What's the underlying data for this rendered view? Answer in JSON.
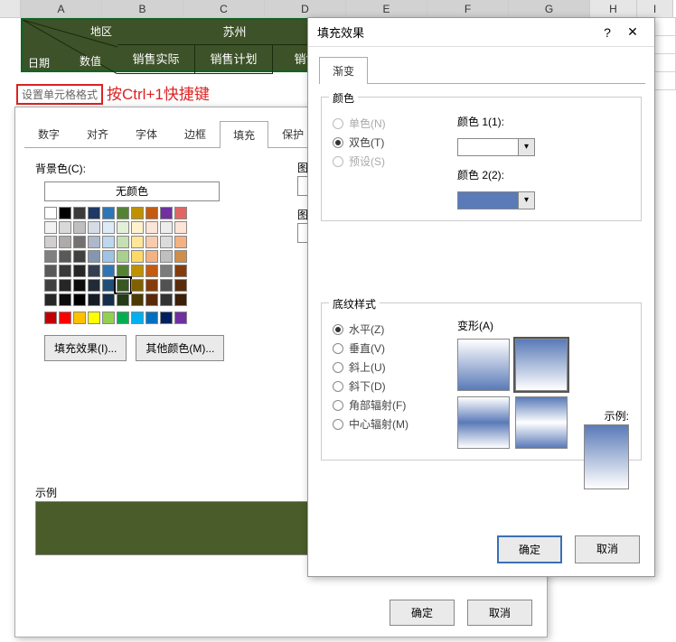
{
  "columns": [
    "A",
    "B",
    "C",
    "D",
    "E",
    "F",
    "G",
    "H",
    "I"
  ],
  "header": {
    "region_label": "地区",
    "date_label": "日期",
    "value_label": "数值",
    "city": "苏州",
    "cols": [
      "销售实际",
      "销售计划",
      "销售实"
    ]
  },
  "annotation": {
    "box": "设置单元格格式",
    "text": "按Ctrl+1快捷键"
  },
  "dlg1": {
    "tabs": [
      "数字",
      "对齐",
      "字体",
      "边框",
      "填充",
      "保护"
    ],
    "active_tab": 4,
    "bg_label": "背景色(C):",
    "no_color": "无颜色",
    "fill_effects_btn": "填充效果(I)...",
    "more_colors_btn": "其他颜色(M)...",
    "pattern_label": "图案",
    "pattern_label2": "图案",
    "sample": "示例",
    "ok": "确定",
    "cancel": "取消",
    "palette_rows": [
      [
        "#ffffff",
        "#000000",
        "#3b3b3b",
        "#1f3864",
        "#2e75b6",
        "#548235",
        "#bf9000",
        "#c55a11",
        "#7030a0",
        "#e06666"
      ],
      [
        "#f2f2f2",
        "#d9d9d9",
        "#bfbfbf",
        "#d6dce5",
        "#deebf7",
        "#e2f0d9",
        "#fff2cc",
        "#fbe5d6",
        "#ededed",
        "#fce4d6"
      ],
      [
        "#d0cece",
        "#aeaaaa",
        "#757171",
        "#adb9ca",
        "#bdd7ee",
        "#c5e0b4",
        "#ffe699",
        "#f8cbad",
        "#dbdbdb",
        "#f4b183"
      ],
      [
        "#808080",
        "#595959",
        "#404040",
        "#8497b0",
        "#9dc3e6",
        "#a9d18e",
        "#ffd966",
        "#f4b183",
        "#bfbfbf",
        "#d08e4b"
      ],
      [
        "#595959",
        "#3a3a3a",
        "#262626",
        "#333f50",
        "#2e75b6",
        "#548235",
        "#bf9000",
        "#c55a11",
        "#7b7b7b",
        "#843c0c"
      ],
      [
        "#404040",
        "#262626",
        "#0d0d0d",
        "#222a35",
        "#1f4e79",
        "#385723",
        "#806000",
        "#843c0c",
        "#525252",
        "#5a2e0d"
      ],
      [
        "#262626",
        "#0d0d0d",
        "#000000",
        "#161c24",
        "#132f49",
        "#243b17",
        "#4d3a00",
        "#5a2a08",
        "#333333",
        "#3b1f09"
      ]
    ],
    "std_colors": [
      "#c00000",
      "#ff0000",
      "#ffc000",
      "#ffff00",
      "#92d050",
      "#00b050",
      "#00b0f0",
      "#0070c0",
      "#002060",
      "#7030a0"
    ],
    "selected": [
      5,
      5
    ]
  },
  "dlg2": {
    "title": "填充效果",
    "tab": "渐变",
    "group_color": "颜色",
    "opt_single": "单色(N)",
    "opt_double": "双色(T)",
    "opt_preset": "预设(S)",
    "color1_label": "颜色 1(1):",
    "color2_label": "颜色 2(2):",
    "color1": "#ffffff",
    "color2": "#5a7ab8",
    "group_style": "底纹样式",
    "styles": [
      "水平(Z)",
      "垂直(V)",
      "斜上(U)",
      "斜下(D)",
      "角部辐射(F)",
      "中心辐射(M)"
    ],
    "style_sel": 0,
    "variants_label": "变形(A)",
    "example_label": "示例:",
    "ok": "确定",
    "cancel": "取消"
  }
}
